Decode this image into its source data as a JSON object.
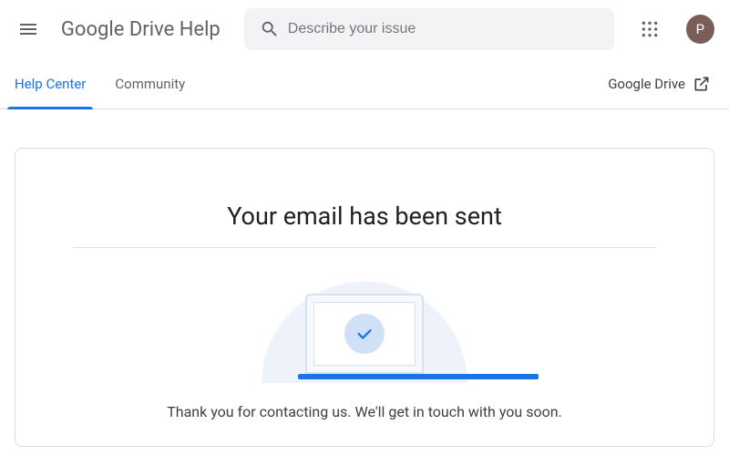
{
  "header": {
    "product_title": "Google Drive Help",
    "search_placeholder": "Describe your issue",
    "avatar_initial": "P"
  },
  "tabs": {
    "help_center": "Help Center",
    "community": "Community",
    "drive_link": "Google Drive"
  },
  "card": {
    "title": "Your email has been sent",
    "message": "Thank you for contacting us. We'll get in touch with you soon."
  }
}
